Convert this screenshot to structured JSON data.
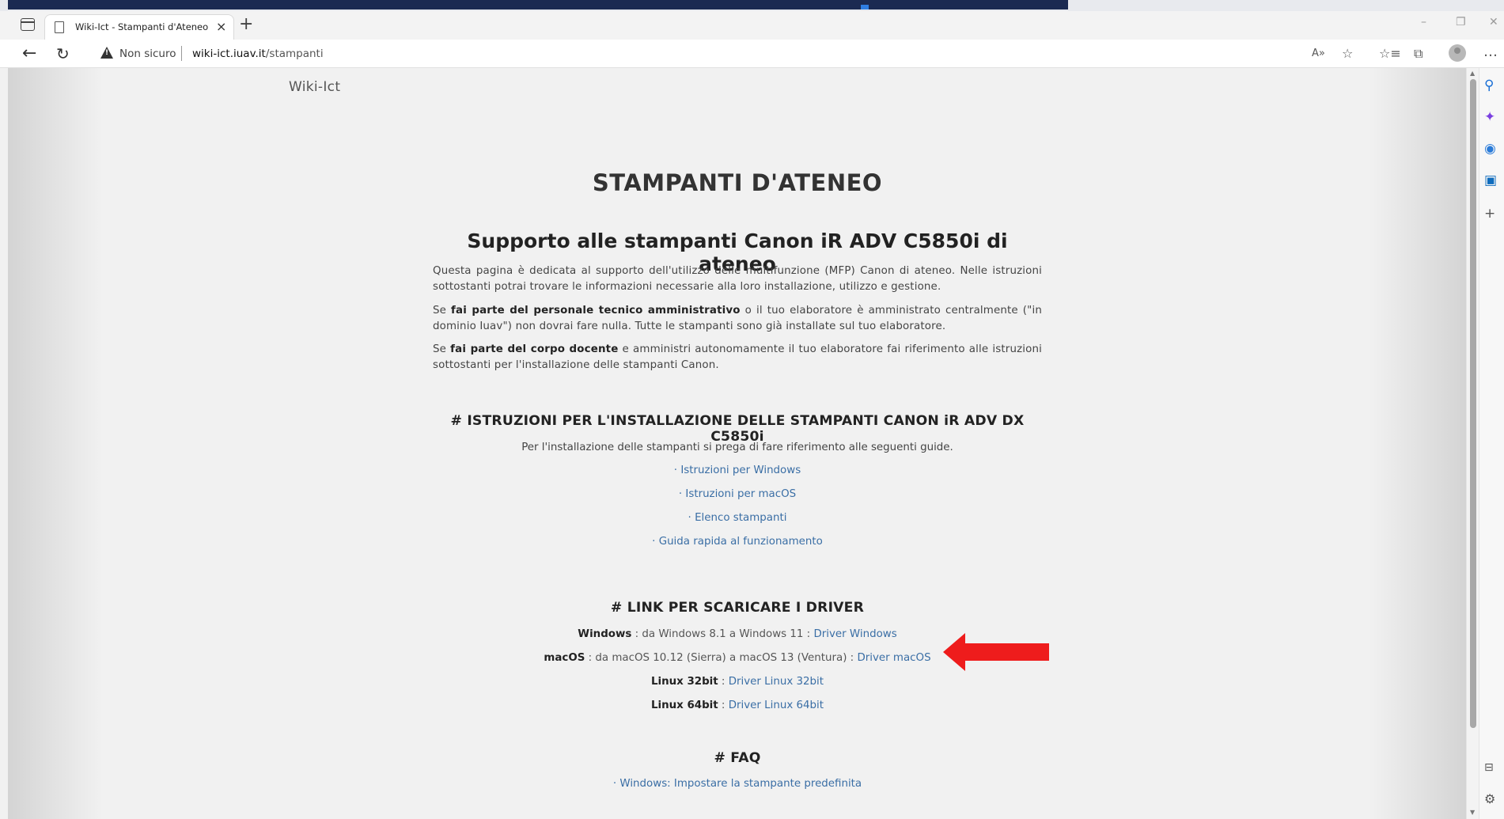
{
  "browser": {
    "tab_title": "Wiki-Ict - Stampanti d'Ateneo",
    "tab_close": "×",
    "new_tab": "+",
    "not_secure_label": "Non sicuro",
    "url_host": "wiki-ict.iuav.it",
    "url_path": "/stampanti",
    "window_controls": [
      "–",
      "❐",
      "✕"
    ],
    "toolbar_icons": [
      "read-aloud-icon",
      "favorite-add-icon",
      "favorites-icon",
      "collections-icon",
      "profile-icon",
      "more-icon"
    ],
    "sidebar_icons": [
      "search-icon",
      "copilot-icon",
      "office-icon",
      "outlook-icon",
      "add-icon",
      "split-screen-icon",
      "settings-icon"
    ]
  },
  "page": {
    "site_logo": "Wiki-Ict",
    "title": "STAMPANTI D'ATENEO",
    "subtitle": "Supporto alle stampanti Canon iR ADV C5850i di ateneo",
    "intro": {
      "p1": "Questa pagina è dedicata al supporto dell'utilizzo delle multifunzione (MFP) Canon di ateneo. Nelle istruzioni sottostanti potrai trovare le informazioni necessarie alla loro installazione, utilizzo e gestione.",
      "p2_prefix": "Se ",
      "p2_bold": "fai parte del personale tecnico amministrativo",
      "p2_suffix": " o il tuo elaboratore è amministrato centralmente (\"in dominio Iuav\") non dovrai fare nulla. Tutte le stampanti sono già installate sul tuo elaboratore.",
      "p3_prefix": "Se ",
      "p3_bold": "fai parte del corpo docente",
      "p3_suffix": " e amministri autonomamente il tuo elaboratore fai riferimento alle istruzioni sottostanti per l'installazione delle stampanti Canon."
    },
    "install_section": {
      "title": "# ISTRUZIONI PER L'INSTALLAZIONE DELLE STAMPANTI CANON iR ADV DX C5850i",
      "text": "Per l'installazione delle stampanti si prega di fare riferimento alle seguenti guide.",
      "bullet": "·",
      "links": [
        "Istruzioni per Windows",
        "Istruzioni per macOS",
        "Elenco stampanti",
        "Guida rapida al funzionamento"
      ]
    },
    "driver_section": {
      "title": "# LINK PER SCARICARE I DRIVER",
      "rows": [
        {
          "os": "Windows",
          "desc": " : da Windows 8.1 a Windows 11 : ",
          "link": "Driver Windows"
        },
        {
          "os": "macOS",
          "desc": " : da macOS 10.12 (Sierra) a macOS 13 (Ventura)  : ",
          "link": "Driver macOS"
        },
        {
          "os": "Linux 32bit",
          "desc": " : ",
          "link": "Driver Linux 32bit"
        },
        {
          "os": "Linux 64bit",
          "desc": " :  ",
          "link": "Driver Linux 64bit"
        }
      ]
    },
    "faq_section": {
      "title": "# FAQ",
      "bullet": "·",
      "links": [
        "Windows: Impostare la stampante predefinita"
      ]
    }
  },
  "colors": {
    "link": "#3a6ea5",
    "annotation_arrow": "#ee1c1c",
    "page_background": "#f1f1f1"
  }
}
